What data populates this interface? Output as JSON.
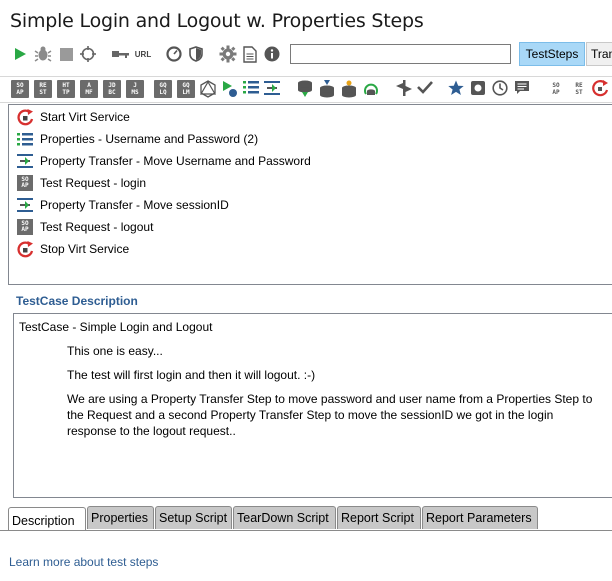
{
  "window": {
    "title": "Simple Login and Logout w. Properties Steps"
  },
  "toolbar": {
    "url_label": "URL",
    "search_value": "",
    "tab_teststeps": "TestSteps",
    "tab_transactions": "Tran"
  },
  "step_toolbar": {
    "soap": [
      "SO",
      "AP"
    ],
    "rest": [
      "RE",
      "ST"
    ],
    "http": [
      "HT",
      "TP"
    ],
    "amf": [
      "A",
      "MF"
    ],
    "jdbc": [
      "JD",
      "BC"
    ],
    "jms": [
      "J",
      "MS"
    ],
    "gqlq": [
      "GQ",
      "LQ"
    ],
    "gqlm": [
      "GQ",
      "LM"
    ],
    "soap_r": [
      "SO",
      "AP"
    ],
    "rest_r": [
      "RE",
      "ST"
    ]
  },
  "steps": [
    {
      "label": "Start Virt Service",
      "icon": "virt-start-icon"
    },
    {
      "label": "Properties - Username and Password (2)",
      "icon": "properties-icon"
    },
    {
      "label": "Property Transfer - Move Username and Password",
      "icon": "property-transfer-icon"
    },
    {
      "label": "Test Request - login",
      "icon": "soap-request-icon"
    },
    {
      "label": "Property Transfer - Move sessionID",
      "icon": "property-transfer-icon"
    },
    {
      "label": "Test Request - logout",
      "icon": "soap-request-icon"
    },
    {
      "label": "Stop Virt Service",
      "icon": "virt-stop-icon"
    }
  ],
  "soap_badge": [
    "SO",
    "AP"
  ],
  "description": {
    "heading": "TestCase Description",
    "line1": "TestCase - Simple Login and Logout",
    "line2": "This one is easy...",
    "line3": "The test will first login and then it will logout. :-)",
    "line4": "We are using a Property Transfer Step to move password and user name from a Properties Step to the Request and a second Property Transfer Step to move the sessionID we got in the login response to the logout request.."
  },
  "bottom_tabs": [
    "Description",
    "Properties",
    "Setup Script",
    "TearDown Script",
    "Report Script",
    "Report Parameters"
  ],
  "footer": {
    "link": "Learn more about test steps"
  },
  "colors": {
    "accent": "#a9d8f7",
    "link": "#2e5d92",
    "run_green": "#2aa845"
  }
}
